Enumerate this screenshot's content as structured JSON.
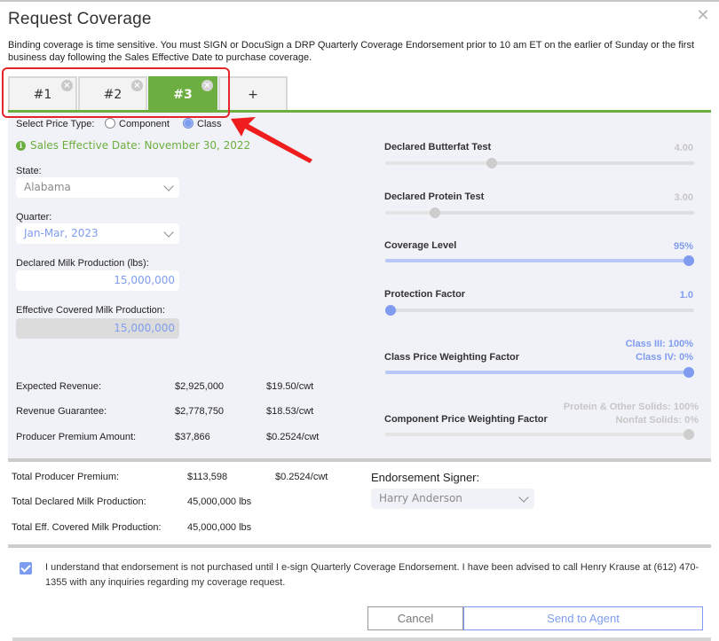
{
  "dialog": {
    "title": "Request Coverage",
    "close_icon": "close-icon",
    "intro": "Binding coverage is time sensitive. You must SIGN or DocuSign a DRP Quarterly Coverage Endorsement prior to 10 am ET on the earlier of Sunday or the first business day following the Sales Effective Date to purchase coverage."
  },
  "tabs": [
    {
      "label": "#1",
      "active": false,
      "closable": true
    },
    {
      "label": "#2",
      "active": false,
      "closable": true
    },
    {
      "label": "#3",
      "active": true,
      "closable": true
    },
    {
      "label": "+",
      "active": false,
      "closable": false
    }
  ],
  "tab_close_glyph": "×",
  "price_type": {
    "label": "Select Price Type:",
    "options": [
      "Component",
      "Class"
    ],
    "selected": "Class"
  },
  "sales_effective": "Sales Effective Date: November 30, 2022",
  "info_glyph": "i",
  "form": {
    "state_label": "State:",
    "state_value": "Alabama",
    "quarter_label": "Quarter:",
    "quarter_value": "Jan-Mar, 2023",
    "declared_label": "Declared Milk Production (lbs):",
    "declared_value": "15,000,000",
    "effective_label": "Effective Covered Milk Production:",
    "effective_value": "15,000,000"
  },
  "summary": [
    {
      "label": "Expected Revenue:",
      "amount": "$2,925,000",
      "per_cwt": "$19.50/cwt"
    },
    {
      "label": "Revenue Guarantee:",
      "amount": "$2,778,750",
      "per_cwt": "$18.53/cwt"
    },
    {
      "label": "Producer Premium Amount:",
      "amount": "$37,866",
      "per_cwt": "$0.2524/cwt"
    }
  ],
  "sliders": {
    "butterfat": {
      "title": "Declared Butterfat Test",
      "value": "4.00",
      "fraction": 0.34
    },
    "protein": {
      "title": "Declared Protein Test",
      "value": "3.00",
      "fraction": 0.15
    },
    "coverage": {
      "title": "Coverage Level",
      "value": "95%",
      "fraction": 1.0
    },
    "protection": {
      "title": "Protection Factor",
      "value": "1.0",
      "fraction": 0.0
    },
    "class_weight": {
      "title": "Class Price Weighting Factor",
      "value_line1": "Class III: 100%",
      "value_line2": "Class IV: 0%",
      "fraction": 1.0
    },
    "component_weight": {
      "title": "Component Price Weighting Factor",
      "value_line1": "Protein & Other Solids: 100%",
      "value_line2": "Nonfat Solids: 0%",
      "fraction": 1.0
    }
  },
  "totals": [
    {
      "label": "Total Producer Premium:",
      "amount": "$113,598",
      "per_cwt": "$0.2524/cwt"
    },
    {
      "label": "Total Declared Milk Production:",
      "amount": "45,000,000 lbs",
      "per_cwt": ""
    },
    {
      "label": "Total Eff. Covered Milk Production:",
      "amount": "45,000,000 lbs",
      "per_cwt": ""
    }
  ],
  "signer": {
    "label": "Endorsement Signer:",
    "value": "Harry Anderson"
  },
  "acknowledgement": {
    "checked": true,
    "text": "I understand that endorsement is not purchased until I e-sign Quarterly Coverage Endorsement. I have been advised to call Henry Krause at (612) 470-1355 with any inquiries regarding my coverage request."
  },
  "buttons": {
    "cancel": "Cancel",
    "send": "Send to Agent"
  },
  "colors": {
    "accent_green": "#6cae3f",
    "accent_blue": "#7f9cf0",
    "annotation_red": "#e4252b"
  }
}
